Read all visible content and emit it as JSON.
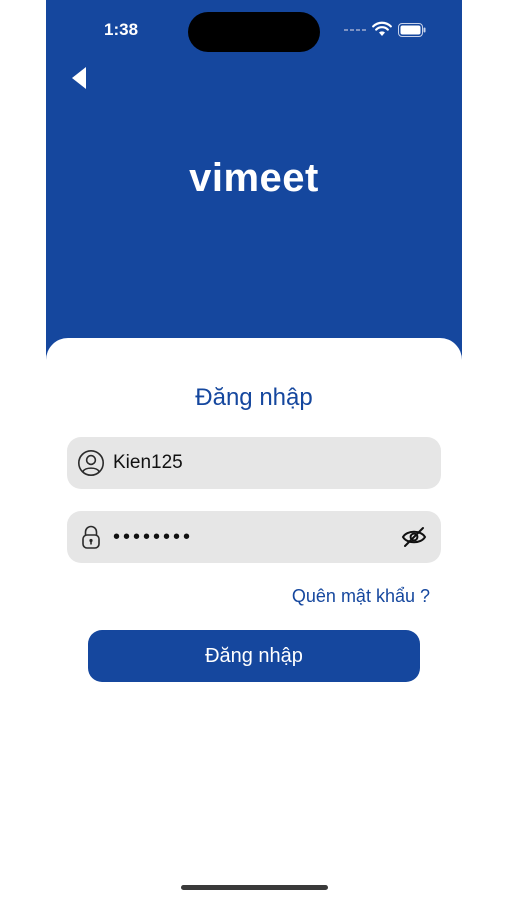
{
  "status_bar": {
    "time": "1:38",
    "icons": [
      "cellular-dots-icon",
      "wifi-icon",
      "battery-icon"
    ]
  },
  "header": {
    "brand": "vimeet",
    "back_icon": "back-arrow-icon"
  },
  "login_form": {
    "title": "Đăng nhập",
    "username": {
      "icon": "user-icon",
      "value": "Kien125"
    },
    "password": {
      "icon": "lock-icon",
      "value": "••••••••",
      "toggle_icon": "eye-slash-icon"
    },
    "forgot_password": "Quên mật khẩu ?",
    "submit_label": "Đăng nhập"
  },
  "colors": {
    "primary": "#15479e",
    "field_background": "#e6e6e6",
    "background": "#ffffff"
  }
}
